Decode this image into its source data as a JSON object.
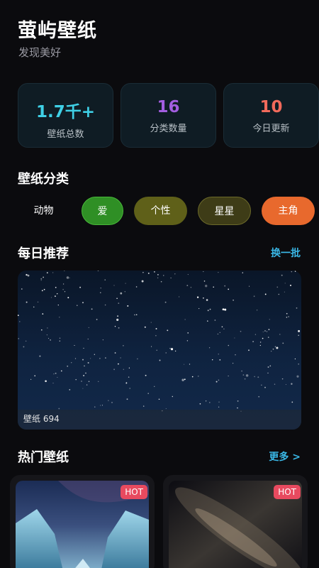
{
  "header": {
    "title": "萤屿壁纸",
    "subtitle": "发现美好"
  },
  "stats": [
    {
      "value": "1.7千+",
      "label": "壁纸总数",
      "color": "#3fd0e6"
    },
    {
      "value": "16",
      "label": "分类数量",
      "color": "#a35ee0"
    },
    {
      "value": "10",
      "label": "今日更新",
      "color": "#f26a5b"
    }
  ],
  "categories": {
    "title": "壁纸分类",
    "items": [
      {
        "label": "动物",
        "color": "transparent"
      },
      {
        "label": "爱",
        "color": "#2f8f25"
      },
      {
        "label": "个性",
        "color": "#5f6019"
      },
      {
        "label": "星星",
        "color": "#3e3c17"
      },
      {
        "label": "主角",
        "color": "#e8692d"
      }
    ]
  },
  "daily": {
    "title": "每日推荐",
    "action": "换一批",
    "featured_caption": "壁纸 694"
  },
  "hot": {
    "title": "热门壁纸",
    "more": "更多 >",
    "badge": "HOT"
  }
}
